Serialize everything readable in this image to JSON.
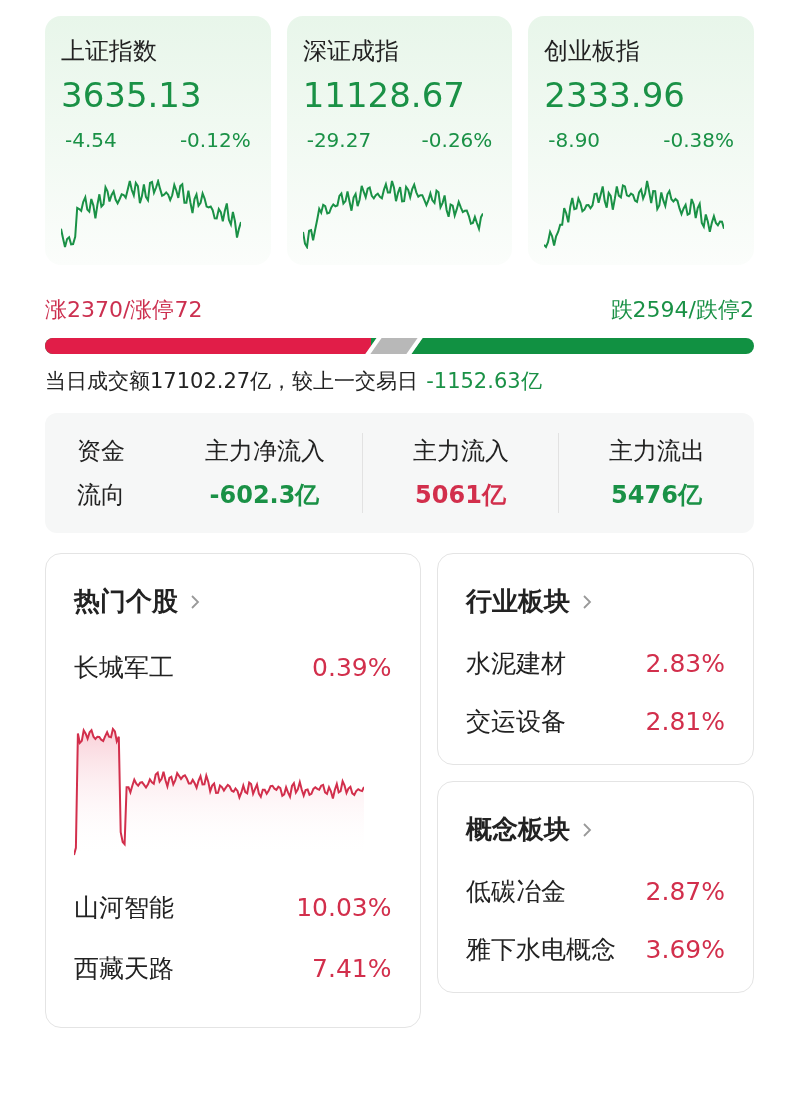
{
  "indices": [
    {
      "name": "上证指数",
      "value": "3635.13",
      "change": "-4.54",
      "percent": "-0.12%",
      "color": "#1a9146"
    },
    {
      "name": "深证成指",
      "value": "11128.67",
      "change": "-29.27",
      "percent": "-0.26%",
      "color": "#1a9146"
    },
    {
      "name": "创业板指",
      "value": "2333.96",
      "change": "-8.90",
      "percent": "-0.38%",
      "color": "#1a9146"
    }
  ],
  "breadth": {
    "up": "涨2370/涨停72",
    "down": "跌2594/跌停2",
    "level": 0.46
  },
  "turnover": {
    "text": "当日成交额17102.27亿，较上一交易日",
    "delta": "-1152.63亿",
    "color": "#1a9146"
  },
  "fund_flow": {
    "title_lines": [
      "资金",
      "流向"
    ],
    "items": [
      {
        "label": "主力净流入",
        "value": "-602.3亿",
        "color": "#1a9146"
      },
      {
        "label": "主力流入",
        "value": "5061亿",
        "color": "#d22f4c"
      },
      {
        "label": "主力流出",
        "value": "5476亿",
        "color": "#1a9146"
      }
    ]
  },
  "hot_stocks": {
    "title": "热门个股",
    "items": [
      {
        "name": "长城军工",
        "percent": "0.39%",
        "color": "#d22f4c"
      },
      {
        "name": "山河智能",
        "percent": "10.03%",
        "color": "#d22f4c"
      },
      {
        "name": "西藏天路",
        "percent": "7.41%",
        "color": "#d22f4c"
      }
    ]
  },
  "sectors": [
    {
      "title": "行业板块",
      "items": [
        {
          "name": "水泥建材",
          "percent": "2.83%",
          "color": "#d22f4c"
        },
        {
          "name": "交运设备",
          "percent": "2.81%",
          "color": "#d22f4c"
        }
      ]
    },
    {
      "title": "概念板块",
      "items": [
        {
          "name": "低碳冶金",
          "percent": "2.87%",
          "color": "#d22f4c"
        },
        {
          "name": "雅下水电概念",
          "percent": "3.69%",
          "color": "#d22f4c"
        }
      ]
    }
  ]
}
